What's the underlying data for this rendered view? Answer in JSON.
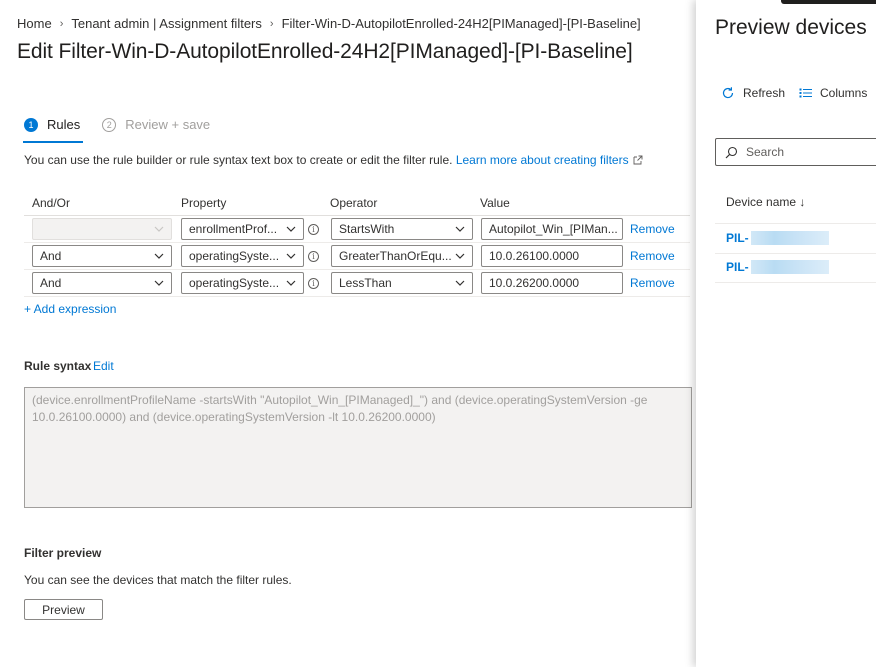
{
  "breadcrumb": [
    "Home",
    "Tenant admin | Assignment filters",
    "Filter-Win-D-AutopilotEnrolled-24H2[PIManaged]-[PI-Baseline]"
  ],
  "title": "Edit Filter-Win-D-AutopilotEnrolled-24H2[PIManaged]-[PI-Baseline]",
  "steps": [
    {
      "num": "1",
      "label": "Rules"
    },
    {
      "num": "2",
      "label": "Review + save"
    }
  ],
  "intro": {
    "text": "You can use the rule builder or rule syntax text box to create or edit the filter rule.",
    "link": "Learn more about creating filters"
  },
  "grid": {
    "headers": {
      "andor": "And/Or",
      "property": "Property",
      "operator": "Operator",
      "value": "Value"
    },
    "rows": [
      {
        "andor": "",
        "property": "enrollmentProf...",
        "operator": "StartsWith",
        "value": "Autopilot_Win_[PIMan...",
        "remove": "Remove"
      },
      {
        "andor": "And",
        "property": "operatingSyste...",
        "operator": "GreaterThanOrEqu...",
        "value": "10.0.26100.0000",
        "remove": "Remove"
      },
      {
        "andor": "And",
        "property": "operatingSyste...",
        "operator": "LessThan",
        "value": "10.0.26200.0000",
        "remove": "Remove"
      }
    ]
  },
  "add_expression": "+ Add expression",
  "rule_syntax": {
    "label": "Rule syntax",
    "edit": "Edit",
    "text": "(device.enrollmentProfileName -startsWith \"Autopilot_Win_[PIManaged]_\") and (device.operatingSystemVersion -ge 10.0.26100.0000) and (device.operatingSystemVersion -lt 10.0.26200.0000)"
  },
  "filter_preview": {
    "label": "Filter preview",
    "desc": "You can see the devices that match the filter rules.",
    "button": "Preview"
  },
  "panel": {
    "title": "Preview devices",
    "refresh": "Refresh",
    "columns": "Columns",
    "search_placeholder": "Search",
    "column_header": "Device name ↓",
    "devices": [
      "PIL-",
      "PIL-"
    ]
  },
  "colors": {
    "accent": "#0078d4",
    "text": "#323130",
    "disabled_text": "#a19f9d"
  }
}
